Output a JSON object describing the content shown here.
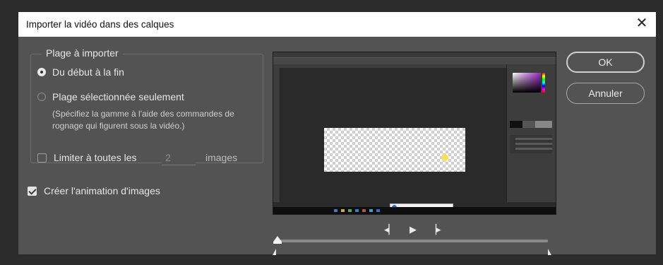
{
  "dialog": {
    "title": "Importer la vidéo dans des calques",
    "close_glyph": "✕"
  },
  "range": {
    "legend": "Plage à importer",
    "option_all": "Du début à la fin",
    "option_all_selected": true,
    "option_selected": "Plage sélectionnée seulement",
    "hint": "(Spécifiez la gamme à l'aide des commandes de rognage qui figurent sous la vidéo.)",
    "limit_label": "Limiter à toutes les",
    "limit_checked": false,
    "limit_value": "2",
    "limit_suffix": "images"
  },
  "animation": {
    "label": "Créer l'animation d'images",
    "checked": true
  },
  "transport": {
    "prev_frame_icon": "step-back-icon",
    "play_icon": "play-icon",
    "next_frame_icon": "step-forward-icon",
    "prev_glyph": "◂▏",
    "play_glyph": "▶",
    "next_glyph": "▕▸"
  },
  "buttons": {
    "ok": "OK",
    "cancel": "Annuler"
  },
  "colors": {
    "dialog_bg": "#535353",
    "titlebar_bg": "#ffffff",
    "text": "#e6e6e6"
  }
}
